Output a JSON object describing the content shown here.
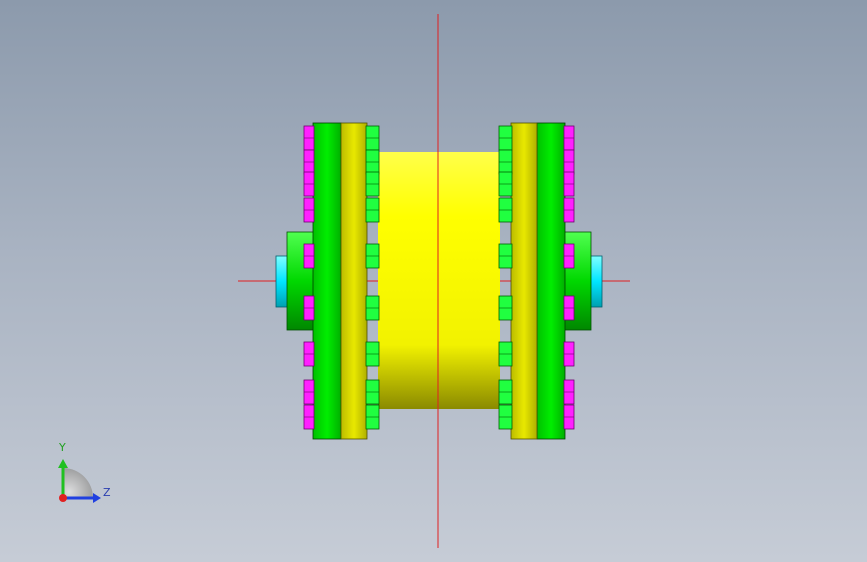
{
  "viewport": {
    "background_top": "#8c9aac",
    "background_bottom": "#c6ccd6"
  },
  "model": {
    "description_colors": {
      "body": "#ffff00",
      "flange": "#00e000",
      "flange_dark": "#00a800",
      "adapter_flange": "#d8d800",
      "bolt_green": "#00ff40",
      "bolt_magenta": "#ff00ff",
      "shaft": "#00e5ff",
      "centerline": "#e02020"
    }
  },
  "triad": {
    "y_label": "Y",
    "z_label": "Z",
    "x_color": "#e02020",
    "y_color": "#20c020",
    "z_color": "#2040e0"
  }
}
